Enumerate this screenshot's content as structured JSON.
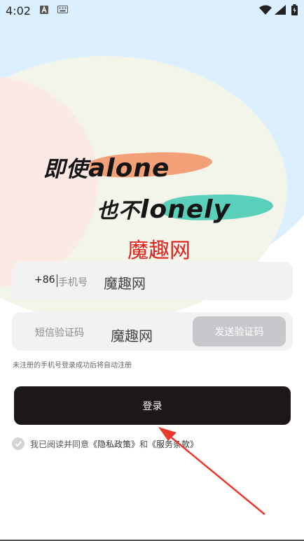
{
  "status_bar": {
    "time": "4:02"
  },
  "banner": {
    "line1_cn": "即使",
    "line1_en": "alone",
    "line2_cn": "也不",
    "line2_en": "lonely",
    "brand": "魔趣网"
  },
  "phone_field": {
    "prefix": "+86",
    "placeholder": "手机号",
    "watermark": "魔趣网"
  },
  "code_field": {
    "placeholder": "短信验证码",
    "watermark": "魔趣网",
    "send_label": "发送验证码"
  },
  "hint": "未注册的手机号登录成功后将自动注册",
  "login_label": "登录",
  "agreement": {
    "prefix": "我已阅读并同意",
    "privacy": "《隐私政策》",
    "and": "和",
    "terms": "《服务条款》"
  },
  "colors": {
    "brand_red": "#e0221f",
    "button_dark": "#1c1719",
    "send_disabled": "#c8c8cc",
    "brush_orange": "#f2a077",
    "brush_teal": "#3ec9b3"
  },
  "icons": [
    "app-a-icon",
    "keyboard-icon",
    "wifi-icon",
    "signal-icon",
    "battery-icon",
    "check-circle-icon"
  ]
}
